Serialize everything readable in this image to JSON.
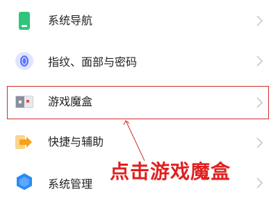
{
  "settings_list": {
    "items": [
      {
        "label": "系统导航",
        "icon": "phone-navigation-icon"
      },
      {
        "label": "指纹、面部与密码",
        "icon": "fingerprint-icon"
      },
      {
        "label": "游戏魔盒",
        "icon": "game-box-icon"
      },
      {
        "label": "快捷与辅助",
        "icon": "shortcut-arrow-icon"
      },
      {
        "label": "系统管理",
        "icon": "hexagon-icon"
      }
    ]
  },
  "annotation": {
    "text": "点击游戏魔盒",
    "color": "#e0201f"
  },
  "colors": {
    "navigation_icon": "#2fc57a",
    "fingerprint_icon": "#5b73ff",
    "game_box_icon": "#8a8f9a",
    "shortcut_icon": "#f7a21b",
    "system_icon": "#2a8af5"
  }
}
